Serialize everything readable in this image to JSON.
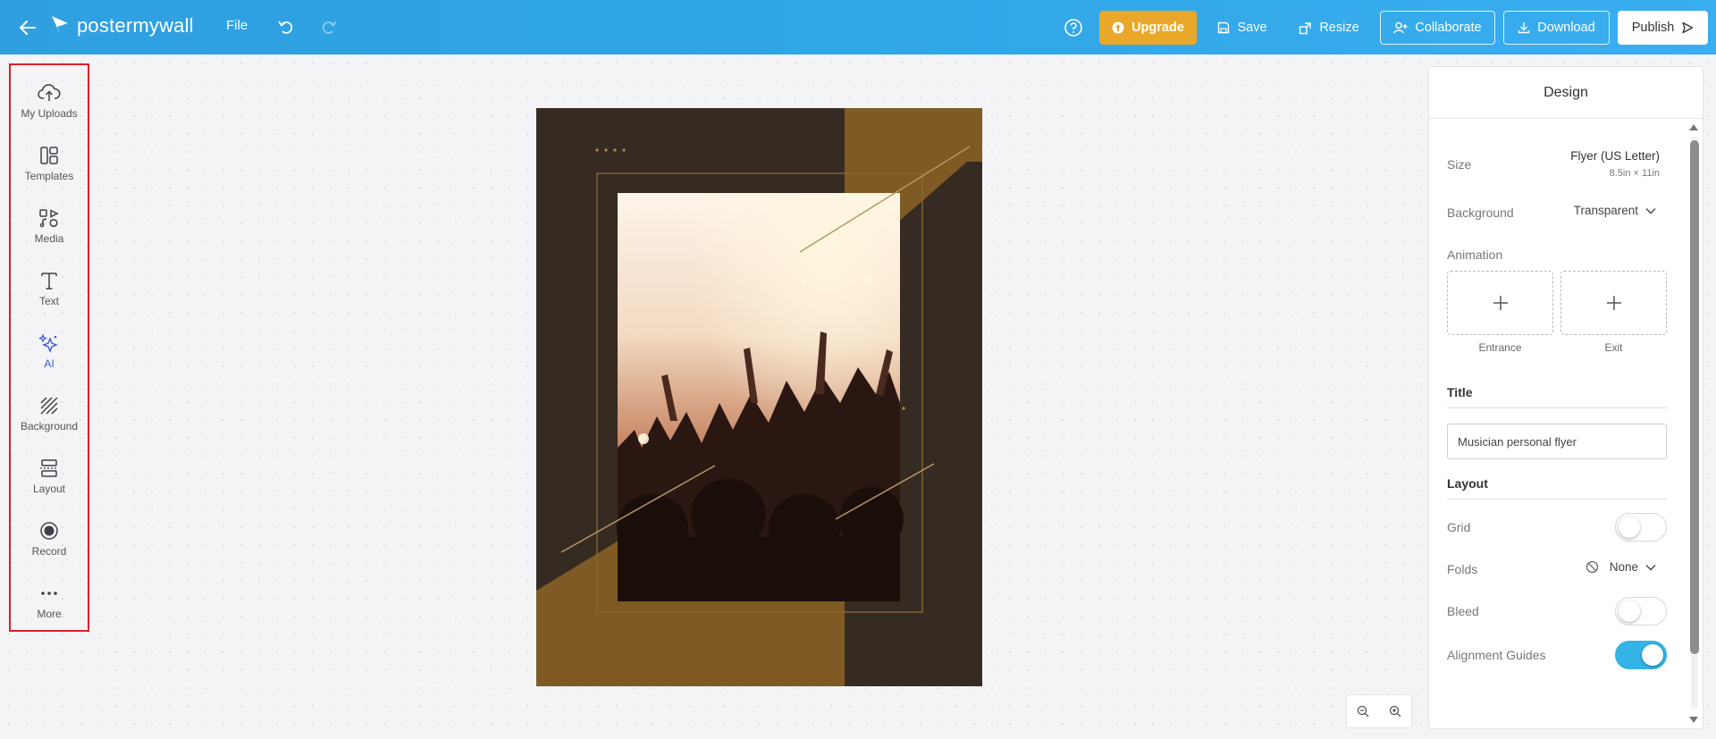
{
  "topbar": {
    "brand": "postermywall",
    "file_label": "File",
    "upgrade_label": "Upgrade",
    "save_label": "Save",
    "resize_label": "Resize",
    "collaborate_label": "Collaborate",
    "download_label": "Download",
    "publish_label": "Publish",
    "icons": [
      "back-arrow-icon",
      "undo-icon",
      "redo-icon",
      "help-icon",
      "upgrade-coin-icon",
      "save-icon",
      "resize-icon",
      "add-user-icon",
      "download-icon",
      "publish-icon"
    ]
  },
  "sidebar": {
    "items": [
      {
        "label": "My Uploads",
        "icon": "upload-cloud-icon"
      },
      {
        "label": "Templates",
        "icon": "templates-icon"
      },
      {
        "label": "Media",
        "icon": "media-icon"
      },
      {
        "label": "Text",
        "icon": "text-icon"
      },
      {
        "label": "AI",
        "icon": "ai-sparkle-icon"
      },
      {
        "label": "Background",
        "icon": "background-hatch-icon"
      },
      {
        "label": "Layout",
        "icon": "layout-icon"
      },
      {
        "label": "Record",
        "icon": "record-icon"
      },
      {
        "label": "More",
        "icon": "more-dots-icon"
      }
    ]
  },
  "design_panel": {
    "title": "Design",
    "size_label": "Size",
    "size_value": "Flyer (US Letter)",
    "size_dims": "8.5in × 11in",
    "background_label": "Background",
    "background_value": "Transparent",
    "animation_label": "Animation",
    "entrance_label": "Entrance",
    "exit_label": "Exit",
    "title_section": "Title",
    "title_value": "Musician personal flyer",
    "layout_section": "Layout",
    "grid_label": "Grid",
    "grid_on": false,
    "folds_label": "Folds",
    "folds_value": "None",
    "bleed_label": "Bleed",
    "bleed_on": false,
    "alignment_label": "Alignment Guides",
    "alignment_on": true
  },
  "colors": {
    "topbar": "#2fa6e6",
    "upgrade": "#e9a829",
    "poster_dark": "#352b22",
    "poster_gold": "#7f5a24",
    "toggle_on": "#33b3e6",
    "sidebar_highlight": "#e0202a"
  }
}
